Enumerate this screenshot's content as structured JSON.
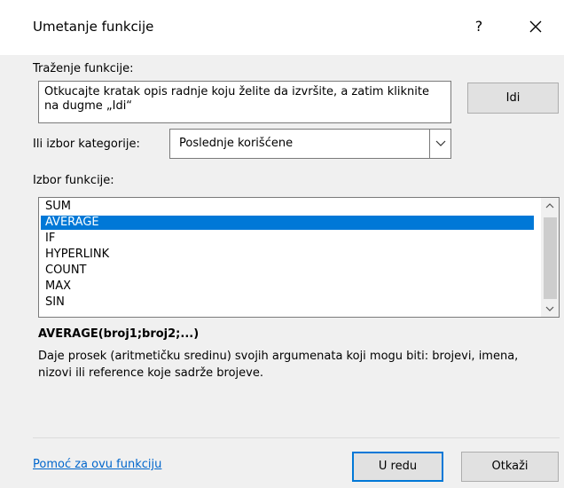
{
  "dialog": {
    "title": "Umetanje funkcije",
    "help_glyph": "?",
    "close_glyph": "×"
  },
  "search": {
    "label": "Traženje funkcije:",
    "text": "Otkucajte kratak opis radnje koju želite da izvršite, a zatim kliknite na dugme „Idi“",
    "go_label": "Idi"
  },
  "category": {
    "label": "Ili izbor kategorije:",
    "selected": "Poslednje korišćene"
  },
  "functions": {
    "label": "Izbor funkcije:",
    "items": [
      "SUM",
      "AVERAGE",
      "IF",
      "HYPERLINK",
      "COUNT",
      "MAX",
      "SIN"
    ],
    "selected": "AVERAGE"
  },
  "details": {
    "signature": "AVERAGE(broj1;broj2;...)",
    "description": "Daje prosek (aritmetičku sredinu) svojih argumenata koji mogu biti: brojevi, imena, nizovi ili reference koje sadrže brojeve."
  },
  "footer": {
    "help_link": "Pomoć za ovu funkciju",
    "ok_label": "U redu",
    "cancel_label": "Otkaži"
  },
  "colors": {
    "accent": "#0078d7",
    "link": "#0066cc"
  }
}
